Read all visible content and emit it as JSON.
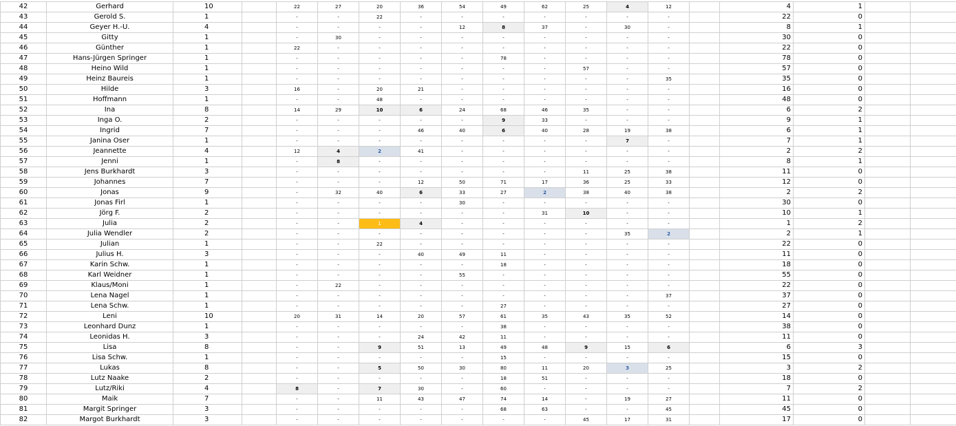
{
  "rows": [
    {
      "n": "42",
      "name": "Gerhard",
      "count": "10",
      "vals": [
        "22",
        "27",
        "20",
        "36",
        "54",
        "49",
        "62",
        "25",
        "4",
        "12"
      ],
      "best": "4",
      "wins": "1"
    },
    {
      "n": "43",
      "name": "Gerold S.",
      "count": "1",
      "vals": [
        "-",
        "-",
        "22",
        "-",
        "-",
        "-",
        "-",
        "-",
        "-",
        "-"
      ],
      "best": "22",
      "wins": "0"
    },
    {
      "n": "44",
      "name": "Geyer H.-U.",
      "count": "4",
      "vals": [
        "-",
        "-",
        "-",
        "-",
        "12",
        "8",
        "37",
        "-",
        "30",
        "-"
      ],
      "best": "8",
      "wins": "1"
    },
    {
      "n": "45",
      "name": "Gitty",
      "count": "1",
      "vals": [
        "-",
        "30",
        "-",
        "-",
        "-",
        "-",
        "-",
        "-",
        "-",
        "-"
      ],
      "best": "30",
      "wins": "0"
    },
    {
      "n": "46",
      "name": "Günther",
      "count": "1",
      "vals": [
        "22",
        "-",
        "-",
        "-",
        "-",
        "-",
        "-",
        "-",
        "-",
        "-"
      ],
      "best": "22",
      "wins": "0"
    },
    {
      "n": "47",
      "name": "Hans-Jürgen Springer",
      "count": "1",
      "vals": [
        "-",
        "-",
        "-",
        "-",
        "-",
        "78",
        "-",
        "-",
        "-",
        "-"
      ],
      "best": "78",
      "wins": "0"
    },
    {
      "n": "48",
      "name": "Heino Wild",
      "count": "1",
      "vals": [
        "-",
        "-",
        "-",
        "-",
        "-",
        "-",
        "-",
        "57",
        "-",
        "-"
      ],
      "best": "57",
      "wins": "0"
    },
    {
      "n": "49",
      "name": "Heinz Baureis",
      "count": "1",
      "vals": [
        "-",
        "-",
        "-",
        "-",
        "-",
        "-",
        "-",
        "-",
        "-",
        "35"
      ],
      "best": "35",
      "wins": "0"
    },
    {
      "n": "50",
      "name": "Hilde",
      "count": "3",
      "vals": [
        "16",
        "-",
        "20",
        "21",
        "-",
        "-",
        "-",
        "-",
        "-",
        "-"
      ],
      "best": "16",
      "wins": "0"
    },
    {
      "n": "51",
      "name": "Hoffmann",
      "count": "1",
      "vals": [
        "-",
        "-",
        "48",
        "-",
        "-",
        "-",
        "-",
        "-",
        "-",
        "-"
      ],
      "best": "48",
      "wins": "0"
    },
    {
      "n": "52",
      "name": "Ina",
      "count": "8",
      "vals": [
        "14",
        "29",
        "10",
        "6",
        "24",
        "68",
        "46",
        "35",
        "-",
        "-"
      ],
      "best": "6",
      "wins": "2"
    },
    {
      "n": "53",
      "name": "Inga O.",
      "count": "2",
      "vals": [
        "-",
        "-",
        "-",
        "-",
        "-",
        "9",
        "33",
        "-",
        "-",
        "-"
      ],
      "best": "9",
      "wins": "1"
    },
    {
      "n": "54",
      "name": "Ingrid",
      "count": "7",
      "vals": [
        "-",
        "-",
        "-",
        "46",
        "40",
        "6",
        "40",
        "28",
        "19",
        "38"
      ],
      "best": "6",
      "wins": "1"
    },
    {
      "n": "55",
      "name": "Janina Oser",
      "count": "1",
      "vals": [
        "-",
        "-",
        "-",
        "-",
        "-",
        "-",
        "-",
        "-",
        "7",
        "-"
      ],
      "best": "7",
      "wins": "1"
    },
    {
      "n": "56",
      "name": "Jeannette",
      "count": "4",
      "vals": [
        "12",
        "4",
        "2",
        "41",
        "-",
        "-",
        "-",
        "-",
        "-",
        "-"
      ],
      "best": "2",
      "wins": "2"
    },
    {
      "n": "57",
      "name": "Jenni",
      "count": "1",
      "vals": [
        "-",
        "8",
        "-",
        "-",
        "-",
        "-",
        "-",
        "-",
        "-",
        "-"
      ],
      "best": "8",
      "wins": "1"
    },
    {
      "n": "58",
      "name": "Jens Burkhardt",
      "count": "3",
      "vals": [
        "-",
        "-",
        "-",
        "-",
        "-",
        "-",
        "-",
        "11",
        "25",
        "38"
      ],
      "best": "11",
      "wins": "0"
    },
    {
      "n": "59",
      "name": "Johannes",
      "count": "7",
      "vals": [
        "-",
        "-",
        "-",
        "12",
        "50",
        "71",
        "17",
        "36",
        "25",
        "33"
      ],
      "best": "12",
      "wins": "0"
    },
    {
      "n": "60",
      "name": "Jonas",
      "count": "9",
      "vals": [
        "-",
        "32",
        "40",
        "6",
        "33",
        "27",
        "2",
        "38",
        "40",
        "38"
      ],
      "best": "2",
      "wins": "2"
    },
    {
      "n": "61",
      "name": "Jonas Firl",
      "count": "1",
      "vals": [
        "-",
        "-",
        "-",
        "-",
        "30",
        "-",
        "-",
        "-",
        "-",
        "-"
      ],
      "best": "30",
      "wins": "0"
    },
    {
      "n": "62",
      "name": "Jörg F.",
      "count": "2",
      "vals": [
        "-",
        "-",
        "-",
        "-",
        "-",
        "-",
        "31",
        "10",
        "-",
        "-"
      ],
      "best": "10",
      "wins": "1"
    },
    {
      "n": "63",
      "name": "Julia",
      "count": "2",
      "vals": [
        "-",
        "-",
        "1",
        "4",
        "-",
        "-",
        "-",
        "-",
        "-",
        "-"
      ],
      "best": "1",
      "wins": "2"
    },
    {
      "n": "64",
      "name": "Julia Wendler",
      "count": "2",
      "vals": [
        "-",
        "-",
        "-",
        "-",
        "-",
        "-",
        "-",
        "-",
        "35",
        "2"
      ],
      "best": "2",
      "wins": "1"
    },
    {
      "n": "65",
      "name": "Julian",
      "count": "1",
      "vals": [
        "-",
        "-",
        "22",
        "-",
        "-",
        "-",
        "-",
        "-",
        "-",
        "-"
      ],
      "best": "22",
      "wins": "0"
    },
    {
      "n": "66",
      "name": "Julius H.",
      "count": "3",
      "vals": [
        "-",
        "-",
        "-",
        "40",
        "49",
        "11",
        "-",
        "-",
        "-",
        "-"
      ],
      "best": "11",
      "wins": "0"
    },
    {
      "n": "67",
      "name": "Karin Schw.",
      "count": "1",
      "vals": [
        "-",
        "-",
        "-",
        "-",
        "-",
        "18",
        "-",
        "-",
        "-",
        "-"
      ],
      "best": "18",
      "wins": "0"
    },
    {
      "n": "68",
      "name": "Karl Weidner",
      "count": "1",
      "vals": [
        "-",
        "-",
        "-",
        "-",
        "55",
        "-",
        "-",
        "-",
        "-",
        "-"
      ],
      "best": "55",
      "wins": "0"
    },
    {
      "n": "69",
      "name": "Klaus/Moni",
      "count": "1",
      "vals": [
        "-",
        "22",
        "-",
        "-",
        "-",
        "-",
        "-",
        "-",
        "-",
        "-"
      ],
      "best": "22",
      "wins": "0"
    },
    {
      "n": "70",
      "name": "Lena Nagel",
      "count": "1",
      "vals": [
        "-",
        "-",
        "-",
        "-",
        "-",
        "-",
        "-",
        "-",
        "-",
        "37"
      ],
      "best": "37",
      "wins": "0"
    },
    {
      "n": "71",
      "name": "Lena Schw.",
      "count": "1",
      "vals": [
        "-",
        "-",
        "-",
        "-",
        "-",
        "27",
        "-",
        "-",
        "-",
        "-"
      ],
      "best": "27",
      "wins": "0"
    },
    {
      "n": "72",
      "name": "Leni",
      "count": "10",
      "vals": [
        "20",
        "31",
        "14",
        "20",
        "57",
        "61",
        "35",
        "43",
        "35",
        "52"
      ],
      "best": "14",
      "wins": "0"
    },
    {
      "n": "73",
      "name": "Leonhard Dunz",
      "count": "1",
      "vals": [
        "-",
        "-",
        "-",
        "-",
        "-",
        "38",
        "-",
        "-",
        "-",
        "-"
      ],
      "best": "38",
      "wins": "0"
    },
    {
      "n": "74",
      "name": "Leonidas H.",
      "count": "3",
      "vals": [
        "-",
        "-",
        "-",
        "24",
        "42",
        "11",
        "-",
        "-",
        "-",
        "-"
      ],
      "best": "11",
      "wins": "0"
    },
    {
      "n": "75",
      "name": "Lisa",
      "count": "8",
      "vals": [
        "-",
        "-",
        "9",
        "51",
        "13",
        "49",
        "48",
        "9",
        "15",
        "6"
      ],
      "best": "6",
      "wins": "3"
    },
    {
      "n": "76",
      "name": "Lisa Schw.",
      "count": "1",
      "vals": [
        "-",
        "-",
        "-",
        "-",
        "-",
        "15",
        "-",
        "-",
        "-",
        "-"
      ],
      "best": "15",
      "wins": "0"
    },
    {
      "n": "77",
      "name": "Lukas",
      "count": "8",
      "vals": [
        "-",
        "-",
        "5",
        "50",
        "30",
        "80",
        "11",
        "20",
        "3",
        "25"
      ],
      "best": "3",
      "wins": "2"
    },
    {
      "n": "78",
      "name": "Lutz Naake",
      "count": "2",
      "vals": [
        "-",
        "-",
        "-",
        "-",
        "-",
        "18",
        "51",
        "-",
        "-",
        "-"
      ],
      "best": "18",
      "wins": "0"
    },
    {
      "n": "79",
      "name": "Lutz/Riki",
      "count": "4",
      "vals": [
        "8",
        "-",
        "7",
        "30",
        "-",
        "60",
        "-",
        "-",
        "-",
        "-"
      ],
      "best": "7",
      "wins": "2"
    },
    {
      "n": "80",
      "name": "Maik",
      "count": "7",
      "vals": [
        "-",
        "-",
        "11",
        "43",
        "47",
        "74",
        "14",
        "-",
        "19",
        "27"
      ],
      "best": "11",
      "wins": "0"
    },
    {
      "n": "81",
      "name": "Margit Springer",
      "count": "3",
      "vals": [
        "-",
        "-",
        "-",
        "-",
        "-",
        "68",
        "63",
        "-",
        "-",
        "45"
      ],
      "best": "45",
      "wins": "0"
    },
    {
      "n": "82",
      "name": "Margot Burkhardt",
      "count": "3",
      "vals": [
        "-",
        "-",
        "-",
        "-",
        "-",
        "-",
        "-",
        "45",
        "17",
        "31"
      ],
      "best": "17",
      "wins": "0"
    }
  ],
  "highlight_colors": {
    "top10_bg": "#efefef",
    "top3_bg": "#d9e0ea",
    "top3_text": "#2c5aa0",
    "first_bg": "#fdbc16",
    "first_text": "#ffffff"
  }
}
